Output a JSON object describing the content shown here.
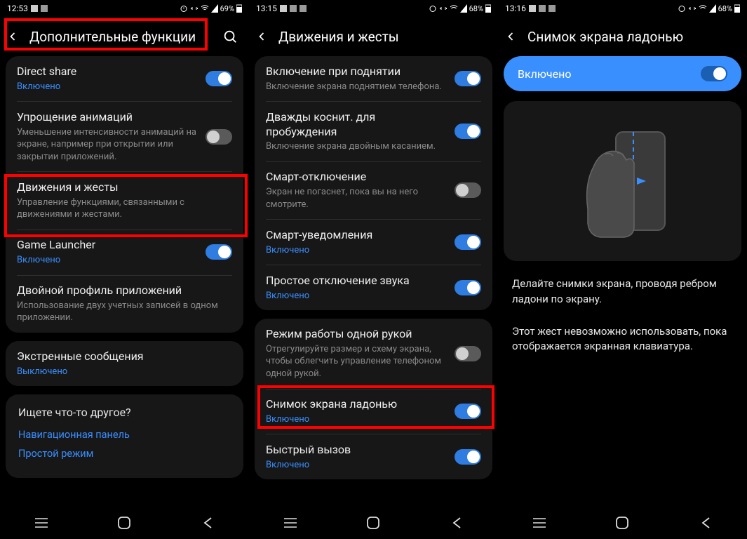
{
  "panel1": {
    "status": {
      "time": "12:53",
      "battery": "69%"
    },
    "header": {
      "title": "Дополнительные функции"
    },
    "rows": [
      {
        "title": "Direct share",
        "sub": "Включено",
        "subBlue": true,
        "toggle": "on"
      },
      {
        "title": "Упрощение анимаций",
        "sub": "Уменьшение интенсивности анимаций на экране, например при открытии или закрытии приложений.",
        "toggle": "off"
      },
      {
        "title": "Движения и жесты",
        "sub": "Управление функциями, связанными с движениями и жестами."
      },
      {
        "title": "Game Launcher",
        "sub": "Включено",
        "subBlue": true,
        "toggle": "on"
      },
      {
        "title": "Двойной профиль приложений",
        "sub": "Использование двух учетных записей в одном приложении."
      },
      {
        "title": "Экстренные сообщения",
        "sub": "Выключено",
        "subBlue": true
      }
    ],
    "more": {
      "q": "Ищете что-то другое?",
      "links": [
        "Навигационная панель",
        "Простой режим"
      ]
    }
  },
  "panel2": {
    "status": {
      "time": "13:15",
      "battery": "68%"
    },
    "header": {
      "title": "Движения и жесты"
    },
    "groups": [
      [
        {
          "title": "Включение при поднятии",
          "sub": "Включение экрана поднятием телефона.",
          "toggle": "on"
        },
        {
          "title": "Дважды коснит. для пробуждения",
          "sub": "Включение экрана двойным касанием.",
          "toggle": "on"
        },
        {
          "title": "Смарт-отключение",
          "sub": "Экран не погаснет, пока вы на него смотрите.",
          "toggle": "off"
        },
        {
          "title": "Смарт-уведомления",
          "sub": "Включено",
          "subBlue": true,
          "toggle": "on"
        },
        {
          "title": "Простое отключение звука",
          "sub": "Включено",
          "subBlue": true,
          "toggle": "on"
        }
      ],
      [
        {
          "title": "Режим работы одной рукой",
          "sub": "Отрегулируйте размер и схему экрана, чтобы облегчить управление телефоном одной рукой.",
          "toggle": "off"
        },
        {
          "title": "Снимок экрана ладонью",
          "sub": "Включено",
          "subBlue": true,
          "toggle": "on"
        },
        {
          "title": "Быстрый вызов",
          "sub": "Включено",
          "subBlue": true,
          "toggle": "on"
        }
      ]
    ]
  },
  "panel3": {
    "status": {
      "time": "13:16",
      "battery": "68%"
    },
    "header": {
      "title": "Снимок экрана ладонью"
    },
    "banner": {
      "label": "Включено"
    },
    "desc1": "Делайте снимки экрана, проводя ребром ладони по экрану.",
    "desc2": "Этот жест невозможно использовать, пока отображается экранная клавиатура."
  }
}
